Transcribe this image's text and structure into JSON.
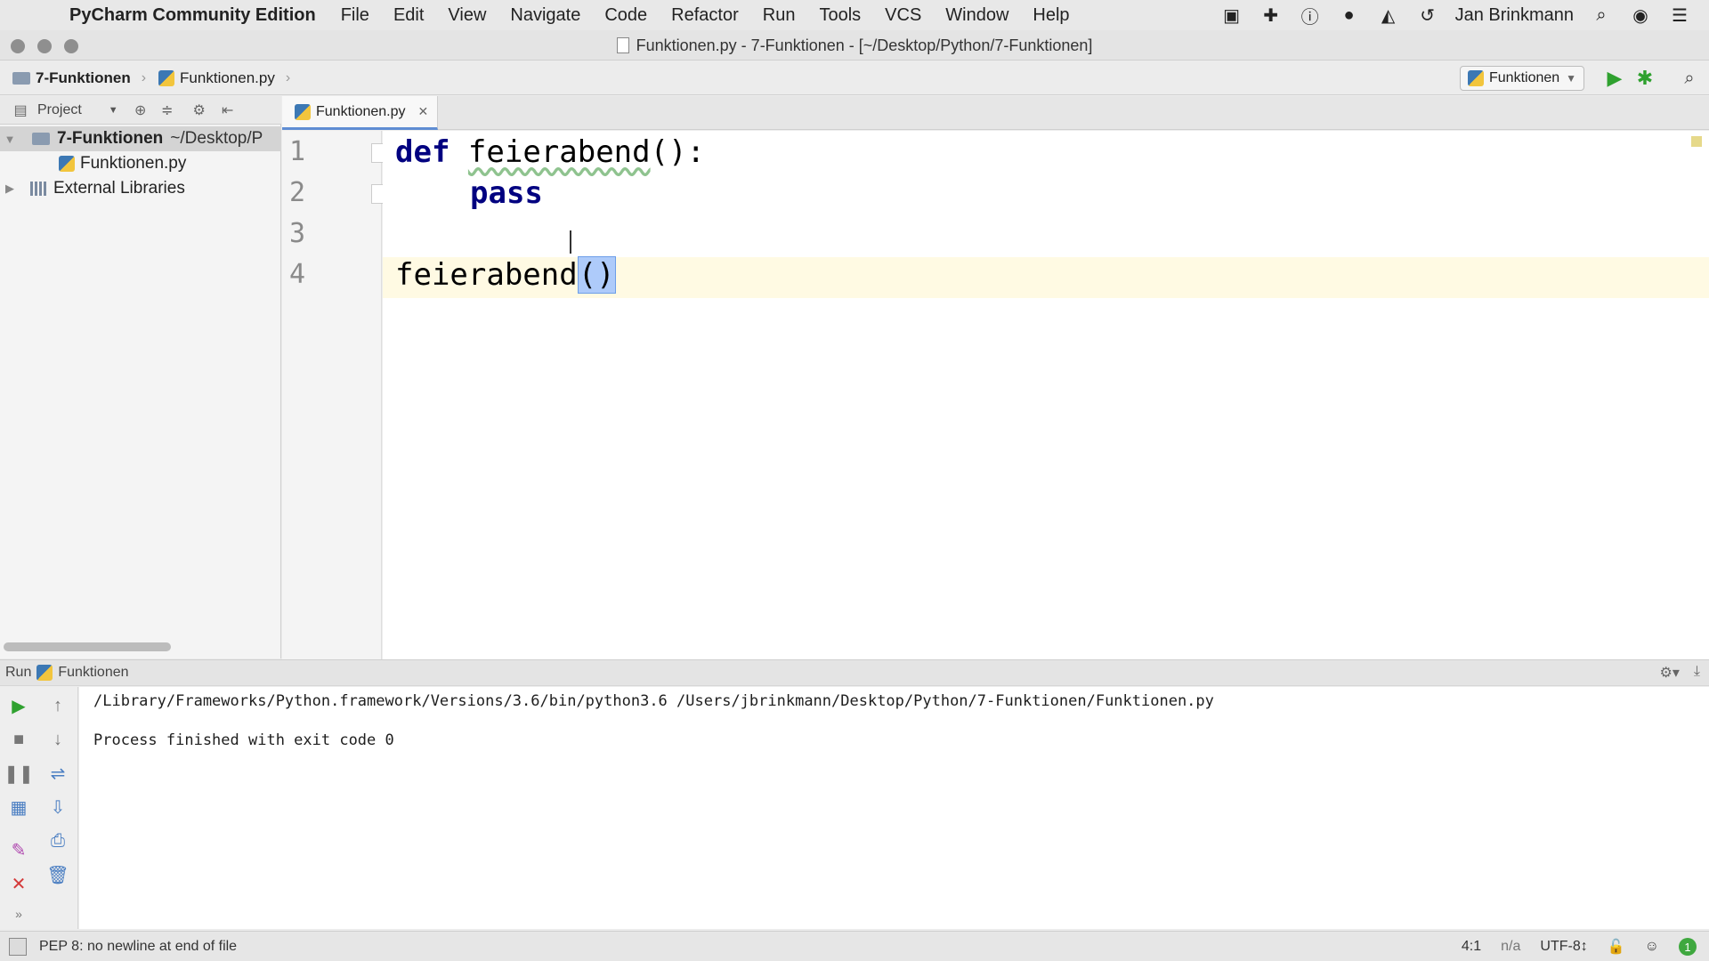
{
  "menubar": {
    "app_name": "PyCharm Community Edition",
    "items": [
      "File",
      "Edit",
      "View",
      "Navigate",
      "Code",
      "Refactor",
      "Run",
      "Tools",
      "VCS",
      "Window",
      "Help"
    ],
    "user": "Jan Brinkmann"
  },
  "window": {
    "title": "Funktionen.py - 7-Funktionen - [~/Desktop/Python/7-Funktionen]"
  },
  "navbar": {
    "crumb_project": "7-Funktionen",
    "crumb_file": "Funktionen.py",
    "run_config": "Funktionen"
  },
  "project_panel": {
    "header": "Project",
    "root_name": "7-Funktionen",
    "root_path": "~/Desktop/P",
    "file": "Funktionen.py",
    "libraries": "External Libraries"
  },
  "editor": {
    "tab_label": "Funktionen.py",
    "line_numbers": [
      "1",
      "2",
      "3",
      "4"
    ],
    "line1_kw": "def",
    "line1_name": "feierabend",
    "line1_tail": "():",
    "line2_kw": "pass",
    "line4_name": "feierabend",
    "line4_parens": "()"
  },
  "run_panel": {
    "label": "Run",
    "config": "Funktionen",
    "output": [
      "/Library/Frameworks/Python.framework/Versions/3.6/bin/python3.6 /Users/jbrinkmann/Desktop/Python/7-Funktionen/Funktionen.py",
      "",
      "Process finished with exit code 0"
    ]
  },
  "statusbar": {
    "message": "PEP 8: no newline at end of file",
    "position": "4:1",
    "na": "n/a",
    "encoding": "UTF-8↕",
    "badge": "1"
  },
  "colors": {
    "keyword": "#000080",
    "run_green": "#2fa12f",
    "selection": "#aecbfa",
    "current_line": "#fffae3"
  }
}
